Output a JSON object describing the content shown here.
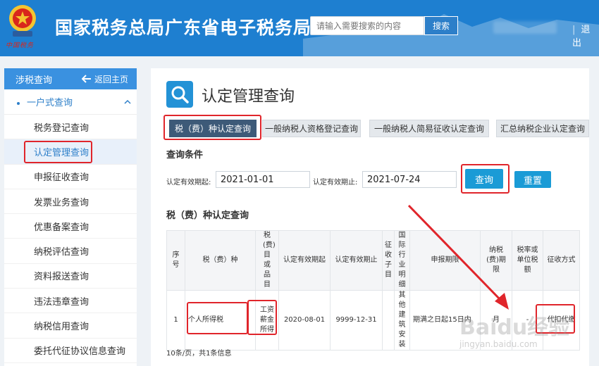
{
  "header": {
    "site_title": "国家税务总局广东省电子税务局",
    "emblem_caption": "中国税务",
    "search_placeholder": "请输入需要搜索的内容",
    "search_button": "搜索",
    "logout": "退出"
  },
  "sidebar": {
    "header_title": "涉税查询",
    "back_label": "返回主页",
    "group_label": "一户式查询",
    "items": [
      {
        "label": "税务登记查询"
      },
      {
        "label": "认定管理查询",
        "active": true
      },
      {
        "label": "申报征收查询"
      },
      {
        "label": "发票业务查询"
      },
      {
        "label": "优惠备案查询"
      },
      {
        "label": "纳税评估查询"
      },
      {
        "label": "资料报送查询"
      },
      {
        "label": "违法违章查询"
      },
      {
        "label": "纳税信用查询"
      },
      {
        "label": "委托代征协议信息查询"
      }
    ]
  },
  "main": {
    "page_title": "认定管理查询",
    "tabs": [
      {
        "label": "税（费）种认定查询",
        "active": true
      },
      {
        "label": "一般纳税人资格登记查询"
      },
      {
        "label": "一般纳税人简易征收认定查询"
      },
      {
        "label": "汇总纳税企业认定查询"
      }
    ],
    "query_section_title": "查询条件",
    "start_label": "认定有效期起:",
    "start_value": "2021-01-01",
    "end_label": "认定有效期止:",
    "end_value": "2021-07-24",
    "query_button": "查询",
    "reset_button": "重置",
    "result_section_title": "税（费）种认定查询",
    "table": {
      "headers": [
        "序号",
        "税（费）种",
        "税(费)目或品目",
        "认定有效期起",
        "认定有效期止",
        "征收子目",
        "国际行业明细",
        "申报期限",
        "纳税(费)期限",
        "税率或单位税额",
        "征收方式"
      ],
      "rows": [
        [
          "1",
          "个人所得税",
          "工资薪金所得",
          "2020-08-01",
          "9999-12-31",
          "",
          "其他建筑安装",
          "期满之日起15日内",
          "月",
          "-",
          "代扣代缴"
        ]
      ]
    },
    "pagination_note": "10条/页，共1条信息"
  },
  "watermark": {
    "main": "Baidu经验",
    "sub": "jingyan.baidu.com"
  },
  "colors": {
    "header_blue": "#1e7fd0",
    "accent_blue": "#1a9bd6",
    "active_tab": "#3d5a78",
    "highlight_red": "#e0252b"
  }
}
